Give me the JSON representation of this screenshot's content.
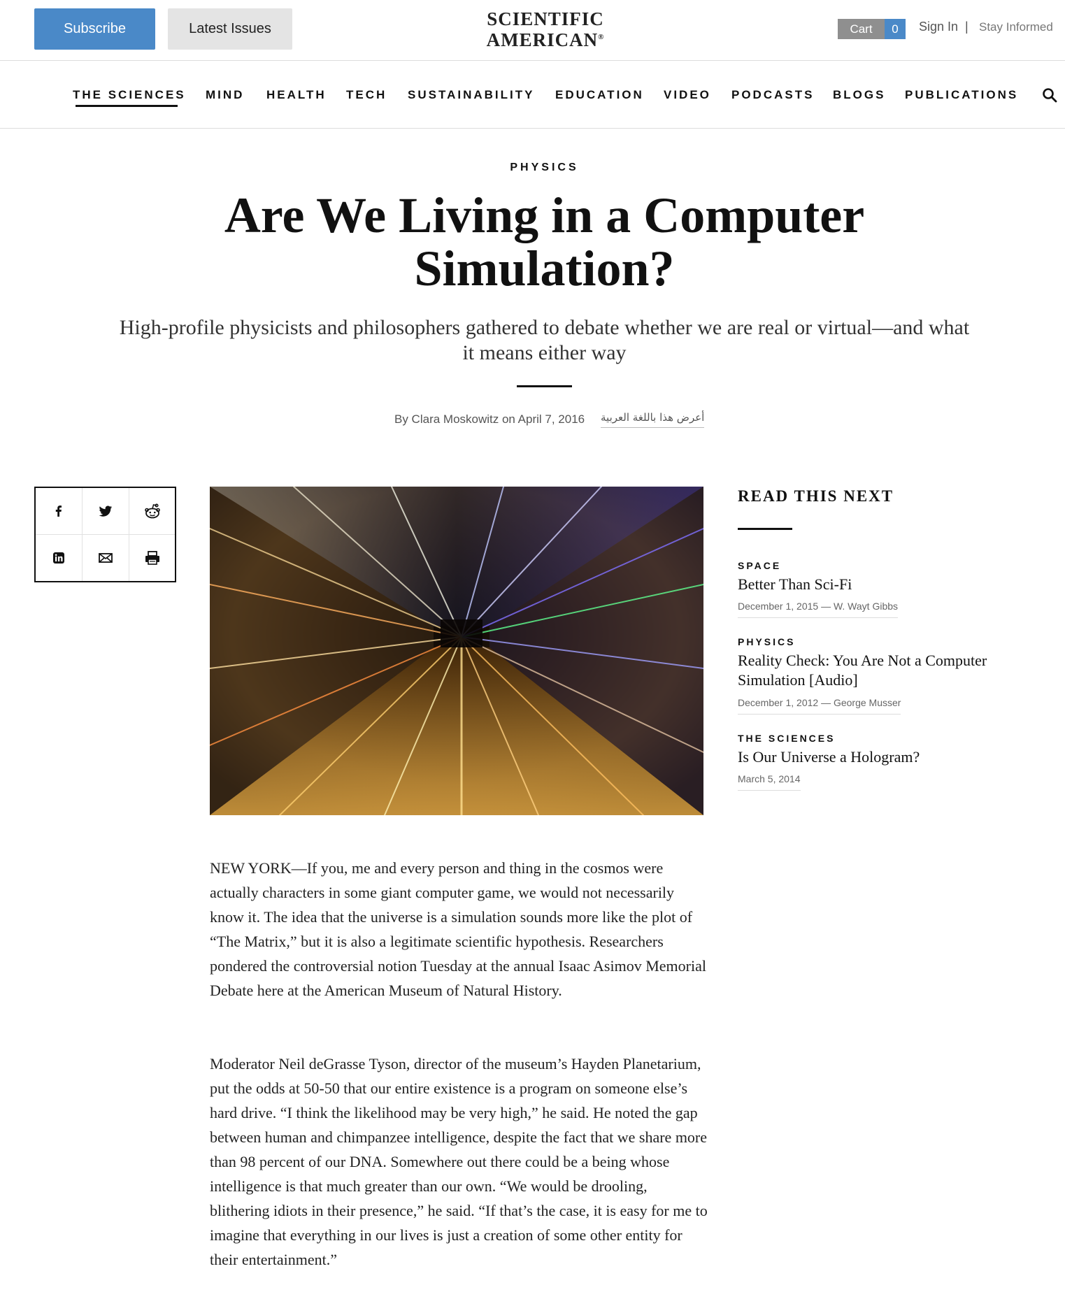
{
  "topbar": {
    "subscribe": "Subscribe",
    "latest_issues": "Latest Issues",
    "logo_line1": "SCIENTIFIC",
    "logo_line2": "AMERICAN",
    "logo_mark": "®",
    "cart_label": "Cart",
    "cart_count": "0",
    "sign_in": "Sign In",
    "separator": "|",
    "stay_informed": "Stay Informed"
  },
  "nav": {
    "items": [
      "THE SCIENCES",
      "MIND",
      "HEALTH",
      "TECH",
      "SUSTAINABILITY",
      "EDUCATION",
      "VIDEO",
      "PODCASTS",
      "BLOGS",
      "PUBLICATIONS"
    ],
    "active": "THE SCIENCES"
  },
  "article": {
    "kicker": "PHYSICS",
    "headline": "Are We Living in a Computer Simulation?",
    "dek": "High-profile physicists and philosophers gathered to debate whether we are real or virtual—and what it means either way",
    "byline": "By Clara Moskowitz on April 7, 2016",
    "arabic_link": "أعرض هذا باللغة العربية",
    "paragraphs": [
      "NEW YORK—If you, me and every person and thing in the cosmos were actually characters in some giant computer game, we would not necessarily know it. The idea that the universe is a simulation sounds more like the plot of “The Matrix,” but it is also a legitimate scientific hypothesis. Researchers pondered the controversial notion Tuesday at the annual Isaac Asimov Memorial Debate here at the American Museum of Natural History.",
      "Moderator Neil deGrasse Tyson, director of the museum’s Hayden Planetarium, put the odds at 50-50 that our entire existence is a program on someone else’s hard drive. “I think the likelihood may be very high,” he said. He noted the gap between human and chimpanzee intelligence, despite the fact that we share more than 98 percent of our DNA. Somewhere out there could be a being whose intelligence is that much greater than our own. “We would be drooling, blithering idiots in their presence,” he said. “If that’s the case, it is easy for me to imagine that everything in our lives is just a creation of some other entity for their entertainment.”"
    ]
  },
  "share": {
    "icons": [
      "facebook-icon",
      "twitter-icon",
      "reddit-icon",
      "linkedin-icon",
      "email-icon",
      "print-icon"
    ]
  },
  "sidebar": {
    "title": "READ THIS NEXT",
    "items": [
      {
        "kicker": "SPACE",
        "title": "Better Than Sci-Fi",
        "meta": "December 1, 2015 — W. Wayt Gibbs"
      },
      {
        "kicker": "PHYSICS",
        "title": "Reality Check: You Are Not a Computer Simulation [Audio]",
        "meta": "December 1, 2012 — George Musser"
      },
      {
        "kicker": "THE SCIENCES",
        "title": "Is Our Universe a Hologram?",
        "meta": "March 5, 2014"
      }
    ]
  },
  "colors": {
    "subscribe_bg": "#4a89c8",
    "latest_bg": "#e4e4e4",
    "cart_label_bg": "#8f8f8f",
    "cart_count_bg": "#4a89c8"
  }
}
